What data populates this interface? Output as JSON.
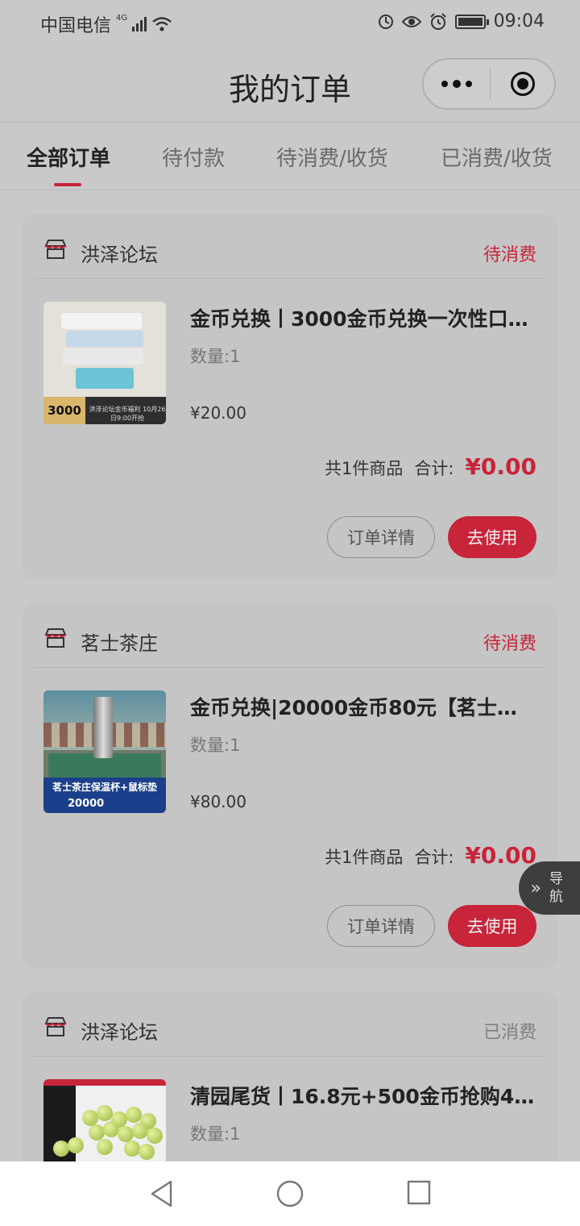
{
  "status_bar": {
    "carrier": "中国电信",
    "network": "4G",
    "time": "09:04",
    "icons": [
      "signal-icon",
      "wifi-icon",
      "data-saver-icon",
      "eye-icon",
      "alarm-icon",
      "battery-icon"
    ]
  },
  "header": {
    "title": "我的订单",
    "capsule_icons": [
      "more-icon",
      "close-target-icon"
    ]
  },
  "tabs": [
    {
      "label": "全部订单",
      "active": true
    },
    {
      "label": "待付款",
      "active": false
    },
    {
      "label": "待消费/收货",
      "active": false
    },
    {
      "label": "已消费/收货",
      "active": false
    }
  ],
  "orders": [
    {
      "shop": "洪泽论坛",
      "status": "待消费",
      "title": "金币兑换丨3000金币兑换一次性口…",
      "quantity": "数量:1",
      "price": "¥20.00",
      "count_text": "共1件商品",
      "total_label": "合计:",
      "total": "¥0.00",
      "btn_detail": "订单详情",
      "btn_use": "去使用",
      "thumb_coin": "3000",
      "thumb_caption": "洪泽论坛金币福利 10月26日9:00开抢"
    },
    {
      "shop": "茗士茶庄",
      "status": "待消费",
      "title": "金币兑换|20000金币80元【茗士茶…",
      "quantity": "数量:1",
      "price": "¥80.00",
      "count_text": "共1件商品",
      "total_label": "合计:",
      "total": "¥0.00",
      "btn_detail": "订单详情",
      "btn_use": "去使用",
      "thumb_banner": "茗士茶庄保温杯+鼠标垫",
      "thumb_coin": "20000"
    },
    {
      "shop": "洪泽论坛",
      "status": "已消费",
      "title": "清园尾货丨16.8元+500金币抢购48…",
      "quantity": "数量:1"
    }
  ],
  "float_nav": {
    "label": "导航"
  },
  "system_nav": [
    "back-icon",
    "home-icon",
    "recents-icon"
  ],
  "colors": {
    "accent": "#c8243a",
    "background": "#c9c9c9"
  }
}
